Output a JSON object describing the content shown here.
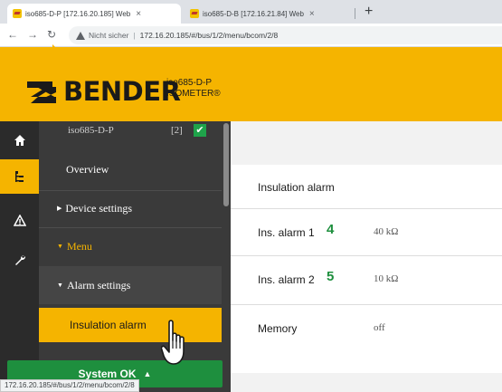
{
  "browser": {
    "tabs": [
      {
        "title": "iso685-D-P [172.16.20.185] Web",
        "close": "×"
      },
      {
        "title": "iso685-D-B [172.16.21.84] Web",
        "close": "×"
      }
    ],
    "new_tab": "+",
    "address": {
      "security_label": "Nicht sicher",
      "separator": "|",
      "url": "172.16.20.185/#/bus/1/2/menu/bcom/2/8"
    },
    "status_url": "172.16.20.185/#/bus/1/2/menu/bcom/2/8"
  },
  "brand": {
    "name": "BENDER",
    "device_name": "iso685-D-P",
    "device_type": "ISOMETER®",
    "accent_color": "#f5b400"
  },
  "sidebar": {
    "device": {
      "label": "iso685-D-P",
      "count": "[2]"
    },
    "items": [
      {
        "label": "Overview"
      },
      {
        "label": "Device settings"
      },
      {
        "label": "Menu"
      },
      {
        "label": "Alarm settings"
      },
      {
        "label": "Insulation alarm"
      }
    ],
    "status": {
      "label": "System OK",
      "color": "#1e8f3e"
    }
  },
  "main": {
    "section_title": "Insulation alarm",
    "rows": [
      {
        "label": "Ins. alarm 1",
        "marker": "4",
        "value": "40 kΩ"
      },
      {
        "label": "Ins. alarm 2",
        "marker": "5",
        "value": "10 kΩ"
      },
      {
        "label": "Memory",
        "marker": "",
        "value": "off"
      }
    ]
  }
}
